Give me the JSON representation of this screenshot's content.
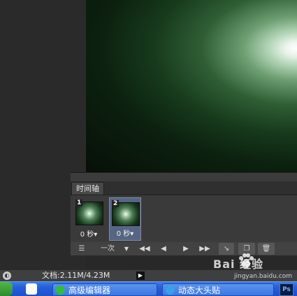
{
  "timeline": {
    "tab_label": "时间轴",
    "frames": [
      {
        "number": "1",
        "delay": "0 秒▾"
      },
      {
        "number": "2",
        "delay": "0 秒▾"
      }
    ],
    "toolbar": {
      "loop_label": "一次",
      "loop_arrow": "▼"
    }
  },
  "statusbar": {
    "doc_info": "文档:2.11M/4.23M",
    "arrow": "▶"
  },
  "taskbar": {
    "buttons": [
      {
        "label": "高级编辑器"
      },
      {
        "label": "动态大头贴"
      }
    ],
    "ps_label": "Ps"
  },
  "watermark": {
    "text": "Bai 经验",
    "sub": "jingyan.baidu.com"
  },
  "colors": {
    "selected_frame": "#566583",
    "panel_bg": "#3c3c3c",
    "taskbar_blue": "#245edb"
  }
}
